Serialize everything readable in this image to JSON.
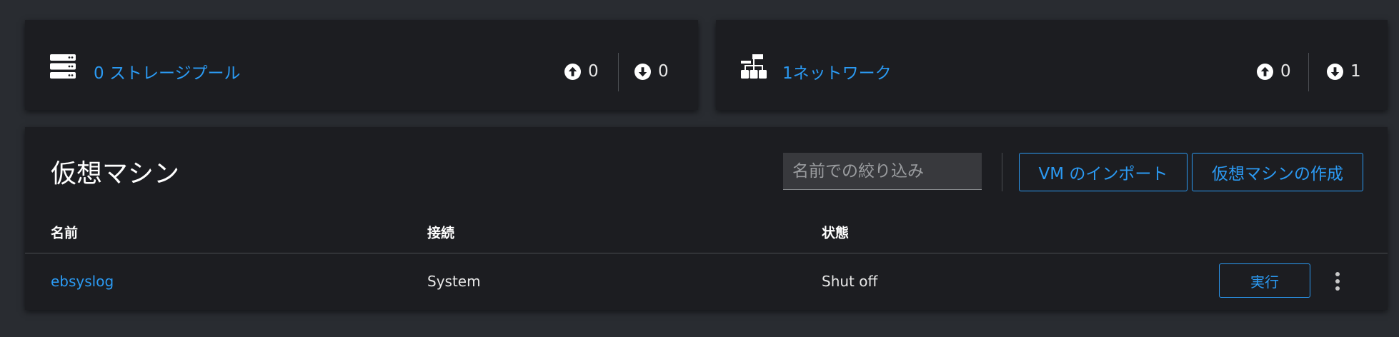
{
  "storage": {
    "icon": "server-stack-icon",
    "link_label": "0 ストレージプール",
    "up_count": "0",
    "down_count": "0"
  },
  "network": {
    "icon": "network-icon",
    "link_label": "1ネットワーク",
    "up_count": "0",
    "down_count": "1"
  },
  "vms": {
    "title": "仮想マシン",
    "filter_placeholder": "名前での絞り込み",
    "import_label": "VM のインポート",
    "create_label": "仮想マシンの作成",
    "columns": [
      "名前",
      "接続",
      "状態"
    ],
    "rows": [
      {
        "name": "ebsyslog",
        "connection": "System",
        "state": "Shut off",
        "action_label": "実行"
      }
    ]
  },
  "colors": {
    "accent": "#2b9af3",
    "page_background": "#292c31",
    "card_background": "#1c1d21"
  }
}
